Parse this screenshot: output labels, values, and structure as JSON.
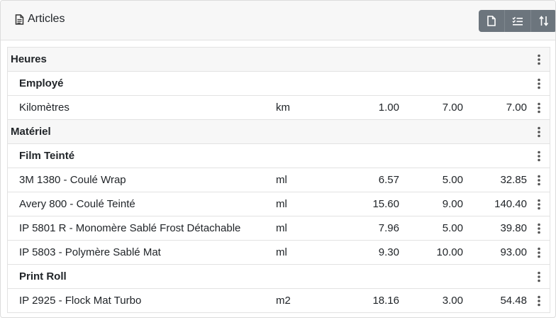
{
  "header": {
    "title": "Articles",
    "buttons": [
      {
        "icon": "new-document-icon"
      },
      {
        "icon": "checklist-icon"
      },
      {
        "icon": "sort-icon"
      }
    ]
  },
  "sections": [
    {
      "kind": "group",
      "label": "Heures"
    },
    {
      "kind": "subgroup",
      "label": "Employé"
    },
    {
      "kind": "item",
      "label": "Kilomètres",
      "unit": "km",
      "qty": "1.00",
      "price": "7.00",
      "total": "7.00"
    },
    {
      "kind": "group",
      "label": "Matériel"
    },
    {
      "kind": "subgroup",
      "label": "Film Teinté"
    },
    {
      "kind": "item",
      "label": "3M 1380 - Coulé Wrap",
      "unit": "ml",
      "qty": "6.57",
      "price": "5.00",
      "total": "32.85"
    },
    {
      "kind": "item",
      "label": "Avery 800 - Coulé Teinté",
      "unit": "ml",
      "qty": "15.60",
      "price": "9.00",
      "total": "140.40"
    },
    {
      "kind": "item",
      "label": "IP 5801 R - Monomère Sablé Frost Détachable",
      "unit": "ml",
      "qty": "7.96",
      "price": "5.00",
      "total": "39.80"
    },
    {
      "kind": "item",
      "label": "IP 5803 - Polymère Sablé Mat",
      "unit": "ml",
      "qty": "9.30",
      "price": "10.00",
      "total": "93.00"
    },
    {
      "kind": "subgroup",
      "label": "Print Roll"
    },
    {
      "kind": "item",
      "label": "IP 2925 - Flock Mat Turbo",
      "unit": "m2",
      "qty": "18.16",
      "price": "3.00",
      "total": "54.48"
    }
  ]
}
